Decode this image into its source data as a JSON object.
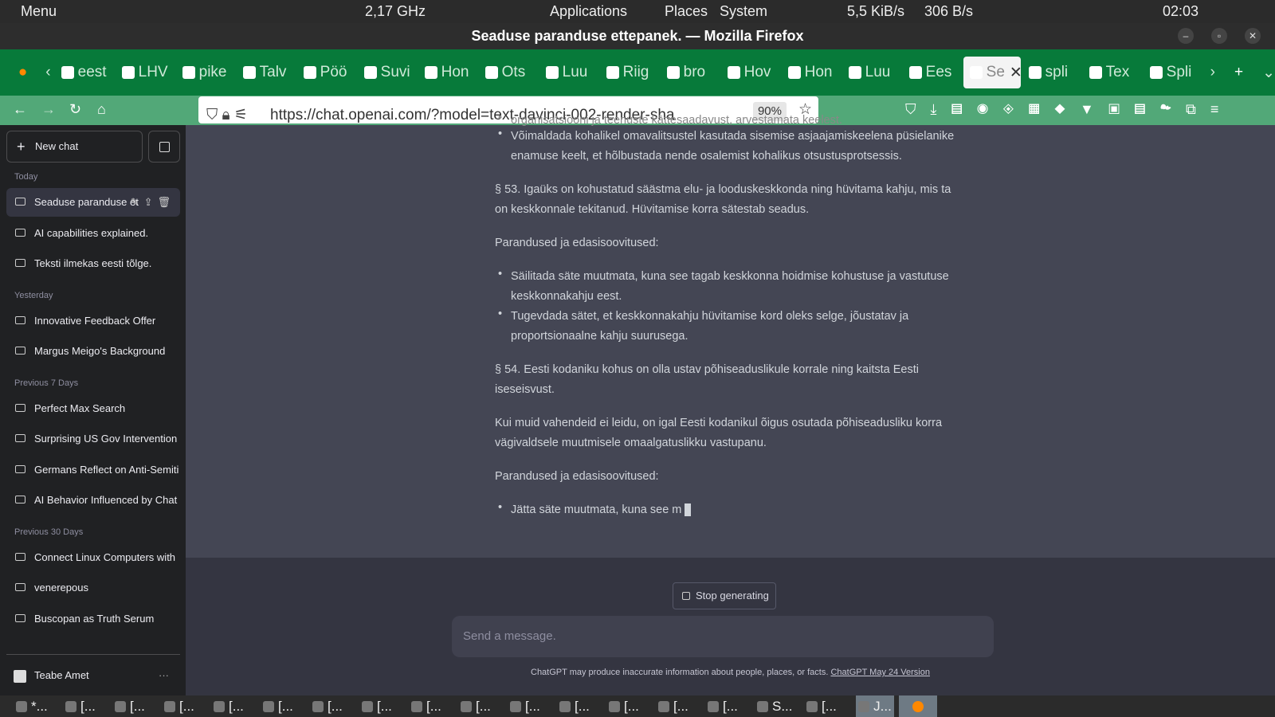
{
  "panel": {
    "menu": "Menu",
    "cpu": "2,17 GHz",
    "applications": "Applications",
    "places": "Places",
    "system": "System",
    "net_down": "5,5 KiB/s",
    "net_up": "306 B/s",
    "time": "02:03"
  },
  "window": {
    "title": "Seaduse paranduse ettepanek. — Mozilla Firefox"
  },
  "tabs": [
    "eest",
    "LHV",
    "pike",
    "Talv",
    "Pöö",
    "Suvi",
    "Hon",
    "Ots",
    "Luu",
    "Riig",
    "bro",
    "Hov",
    "Hon",
    "Luu",
    "Ees",
    "Se",
    "spli",
    "Tex",
    "Spli"
  ],
  "nav": {
    "url": "https://chat.openai.com/?model=text-davinci-002-render-sha",
    "zoom": "90%"
  },
  "sidebar": {
    "new_chat": "New chat",
    "sections": [
      {
        "label": "Today",
        "items": [
          "Seaduse paranduse et",
          "AI capabilities explained.",
          "Teksti ilmekas eesti tõlge."
        ]
      },
      {
        "label": "Yesterday",
        "items": [
          "Innovative Feedback Offer",
          "Margus Meigo's Background"
        ]
      },
      {
        "label": "Previous 7 Days",
        "items": [
          "Perfect Max Search",
          "Surprising US Gov Intervention",
          "Germans Reflect on Anti-Semiti",
          "AI Behavior Influenced by Chat"
        ]
      },
      {
        "label": "Previous 30 Days",
        "items": [
          "Connect Linux Computers with",
          "venerepous",
          "Buscopan as Truth Serum"
        ]
      }
    ],
    "user": "Teabe Amet",
    "more": "···"
  },
  "message": {
    "cut_line": "organisatsiooni ja teenuste kättesaadavust, arvestamata keelest.",
    "b0": "Võimaldada kohalikel omavalitsustel kasutada sisemise asjaajamiskeelena püsielanike enamuse keelt, et hõlbustada nende osalemist kohalikus otsustusprotsessis.",
    "p1": "§ 53. Igaüks on kohustatud säästma elu- ja looduskeskkonda ning hüvitama kahju, mis ta on keskkonnale tekitanud. Hüvitamise korra sätestab seadus.",
    "p2": "Parandused ja edasisoovitused:",
    "b1": "Säilitada säte muutmata, kuna see tagab keskkonna hoidmise kohustuse ja vastutuse keskkonnakahju eest.",
    "b2": "Tugevdada sätet, et keskkonnakahju hüvitamise kord oleks selge, jõustatav ja proportsionaalne kahju suurusega.",
    "p3": "§ 54. Eesti kodaniku kohus on olla ustav põhiseaduslikule korrale ning kaitsta Eesti iseseisvust.",
    "p4": "Kui muid vahendeid ei leidu, on igal Eesti kodanikul õigus osutada põhiseadusliku korra vägivaldsele muutmisele omaalgatuslikku vastupanu.",
    "p5": "Parandused ja edasisoovitused:",
    "b3": "Jätta säte muutmata, kuna see m"
  },
  "composer": {
    "stop": "Stop generating",
    "placeholder": "Send a message.",
    "disclaimer": "ChatGPT may produce inaccurate information about people, places, or facts.",
    "version_link": "ChatGPT May 24 Version"
  },
  "taskbar": {
    "items": [
      "*...",
      "[...",
      "[...",
      "[...",
      "[...",
      "[...",
      "[...",
      "[...",
      "[...",
      "[...",
      "[...",
      "[...",
      "[...",
      "[...",
      "[...",
      "S...",
      "[...",
      "J..."
    ]
  }
}
